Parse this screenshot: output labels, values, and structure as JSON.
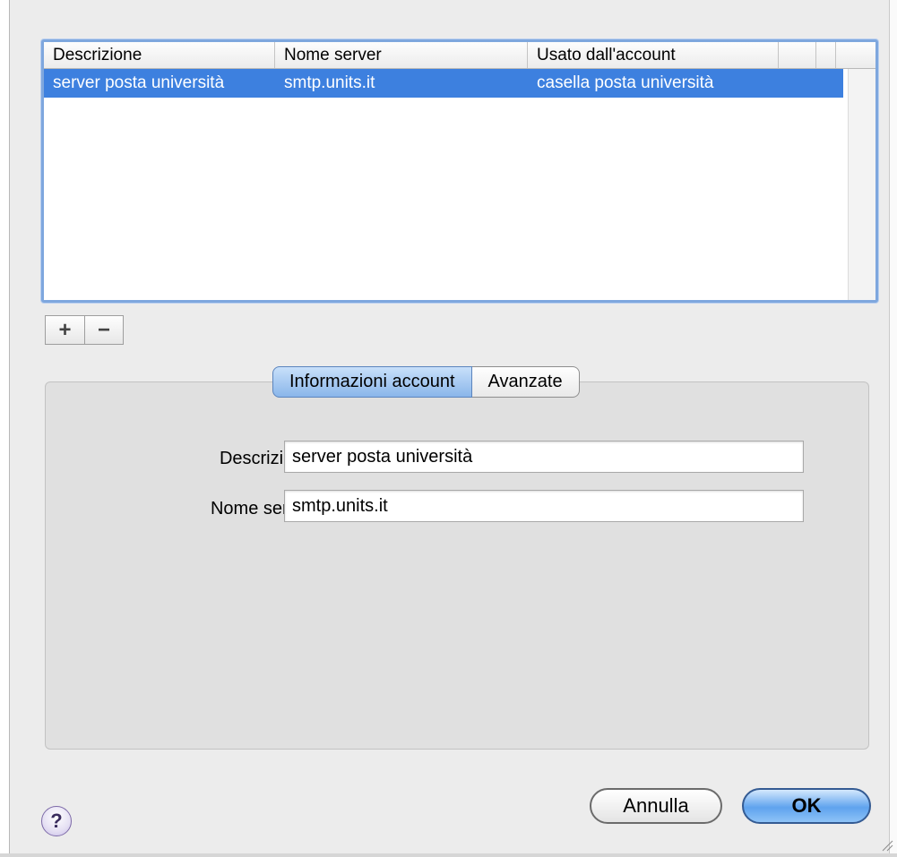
{
  "table": {
    "columns": [
      "Descrizione",
      "Nome server",
      "Usato dall'account"
    ],
    "rows": [
      [
        "server posta università",
        "smtp.units.it",
        "casella posta università"
      ]
    ]
  },
  "list_controls": {
    "add_label": "+",
    "remove_label": "−"
  },
  "tabs": [
    {
      "label": "Informazioni account",
      "selected": true
    },
    {
      "label": "Avanzate",
      "selected": false
    }
  ],
  "form": {
    "description_label": "Descrizione:",
    "description_value": "server posta università",
    "server_label": "Nome server:",
    "server_value": "smtp.units.it"
  },
  "buttons": {
    "help_label": "?",
    "cancel_label": "Annulla",
    "ok_label": "OK"
  },
  "colors": {
    "selection": "#3d80df",
    "focus_ring": "#7ea7de",
    "ok_button": "#5fa3ee"
  }
}
